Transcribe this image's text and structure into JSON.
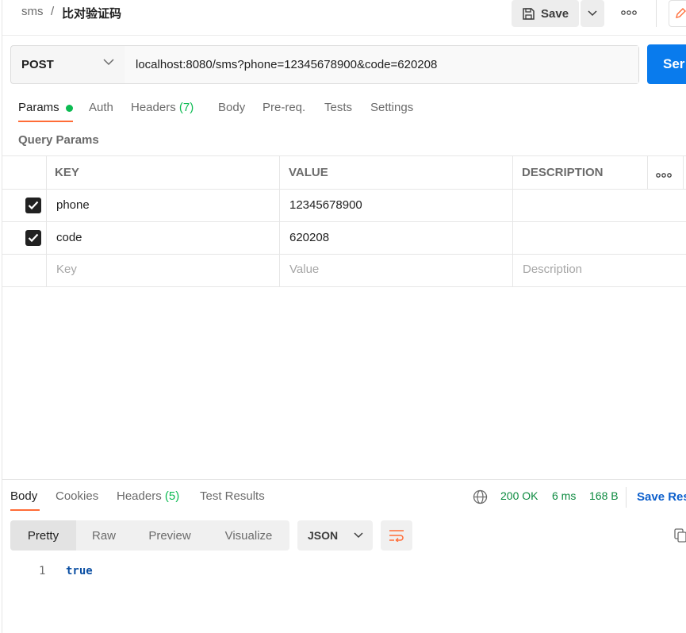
{
  "breadcrumb": {
    "parent": "sms",
    "separator": "/",
    "title": "比对验证码"
  },
  "toolbar": {
    "save_label": "Save"
  },
  "request": {
    "method": "POST",
    "url": "localhost:8080/sms?phone=12345678900&code=620208",
    "send_label": "Ser"
  },
  "request_tabs": {
    "params": "Params",
    "auth": "Auth",
    "headers": "Headers",
    "headers_count": "(7)",
    "body": "Body",
    "prereq": "Pre-req.",
    "tests": "Tests",
    "settings": "Settings"
  },
  "query_params": {
    "title": "Query Params",
    "columns": {
      "key": "KEY",
      "value": "VALUE",
      "description": "DESCRIPTION"
    },
    "rows": [
      {
        "key": "phone",
        "value": "12345678900",
        "description": ""
      },
      {
        "key": "code",
        "value": "620208",
        "description": ""
      }
    ],
    "placeholders": {
      "key": "Key",
      "value": "Value",
      "description": "Description"
    }
  },
  "response_tabs": {
    "body": "Body",
    "cookies": "Cookies",
    "headers": "Headers",
    "headers_count": "(5)",
    "test_results": "Test Results"
  },
  "response_status": {
    "status": "200 OK",
    "time": "6 ms",
    "size": "168 B",
    "save_label": "Save Res"
  },
  "view_modes": {
    "pretty": "Pretty",
    "raw": "Raw",
    "preview": "Preview",
    "visualize": "Visualize"
  },
  "format": {
    "selected": "JSON"
  },
  "response_body": {
    "line_number": "1",
    "content": "true"
  },
  "colors": {
    "accent": "#ff6c37",
    "send": "#097bed",
    "success": "#0cbb52"
  }
}
